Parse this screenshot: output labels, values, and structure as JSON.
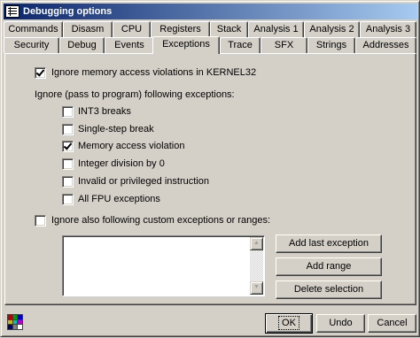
{
  "window": {
    "title": "Debugging options"
  },
  "tabs_row1": [
    "Commands",
    "Disasm",
    "CPU",
    "Registers",
    "Stack",
    "Analysis 1",
    "Analysis 2",
    "Analysis 3"
  ],
  "tabs_row2": [
    "Security",
    "Debug",
    "Events",
    "Exceptions",
    "Trace",
    "SFX",
    "Strings",
    "Addresses"
  ],
  "active_tab": "Exceptions",
  "options": {
    "ignore_kernel32": {
      "label": "Ignore memory access violations in KERNEL32",
      "checked": true
    },
    "section_label": "Ignore (pass to program) following exceptions:",
    "exceptions": [
      {
        "label": "INT3 breaks",
        "checked": false
      },
      {
        "label": "Single-step break",
        "checked": false
      },
      {
        "label": "Memory access violation",
        "checked": true
      },
      {
        "label": "Integer division by 0",
        "checked": false
      },
      {
        "label": "Invalid or privileged instruction",
        "checked": false
      },
      {
        "label": "All FPU exceptions",
        "checked": false
      }
    ],
    "custom": {
      "label": "Ignore also following custom exceptions or ranges:",
      "checked": false
    }
  },
  "custom_buttons": {
    "add_last": "Add last exception",
    "add_range": "Add range",
    "delete": "Delete selection"
  },
  "footer": {
    "ok": "OK",
    "undo": "Undo",
    "cancel": "Cancel"
  },
  "icons": {
    "title": "options-window-icon",
    "palette": "color-palette-icon",
    "scroll_up": "scroll-up-arrow-icon",
    "scroll_down": "scroll-down-arrow-icon"
  },
  "colors": {
    "titlebar_start": "#0a246a",
    "titlebar_end": "#a6caf0",
    "face": "#d4d0c8",
    "palette": [
      "#c00000",
      "#00a000",
      "#0000c0",
      "#c0c000",
      "#00c0c0",
      "#c000c0",
      "#000080",
      "#808080",
      "#ffffff"
    ]
  }
}
